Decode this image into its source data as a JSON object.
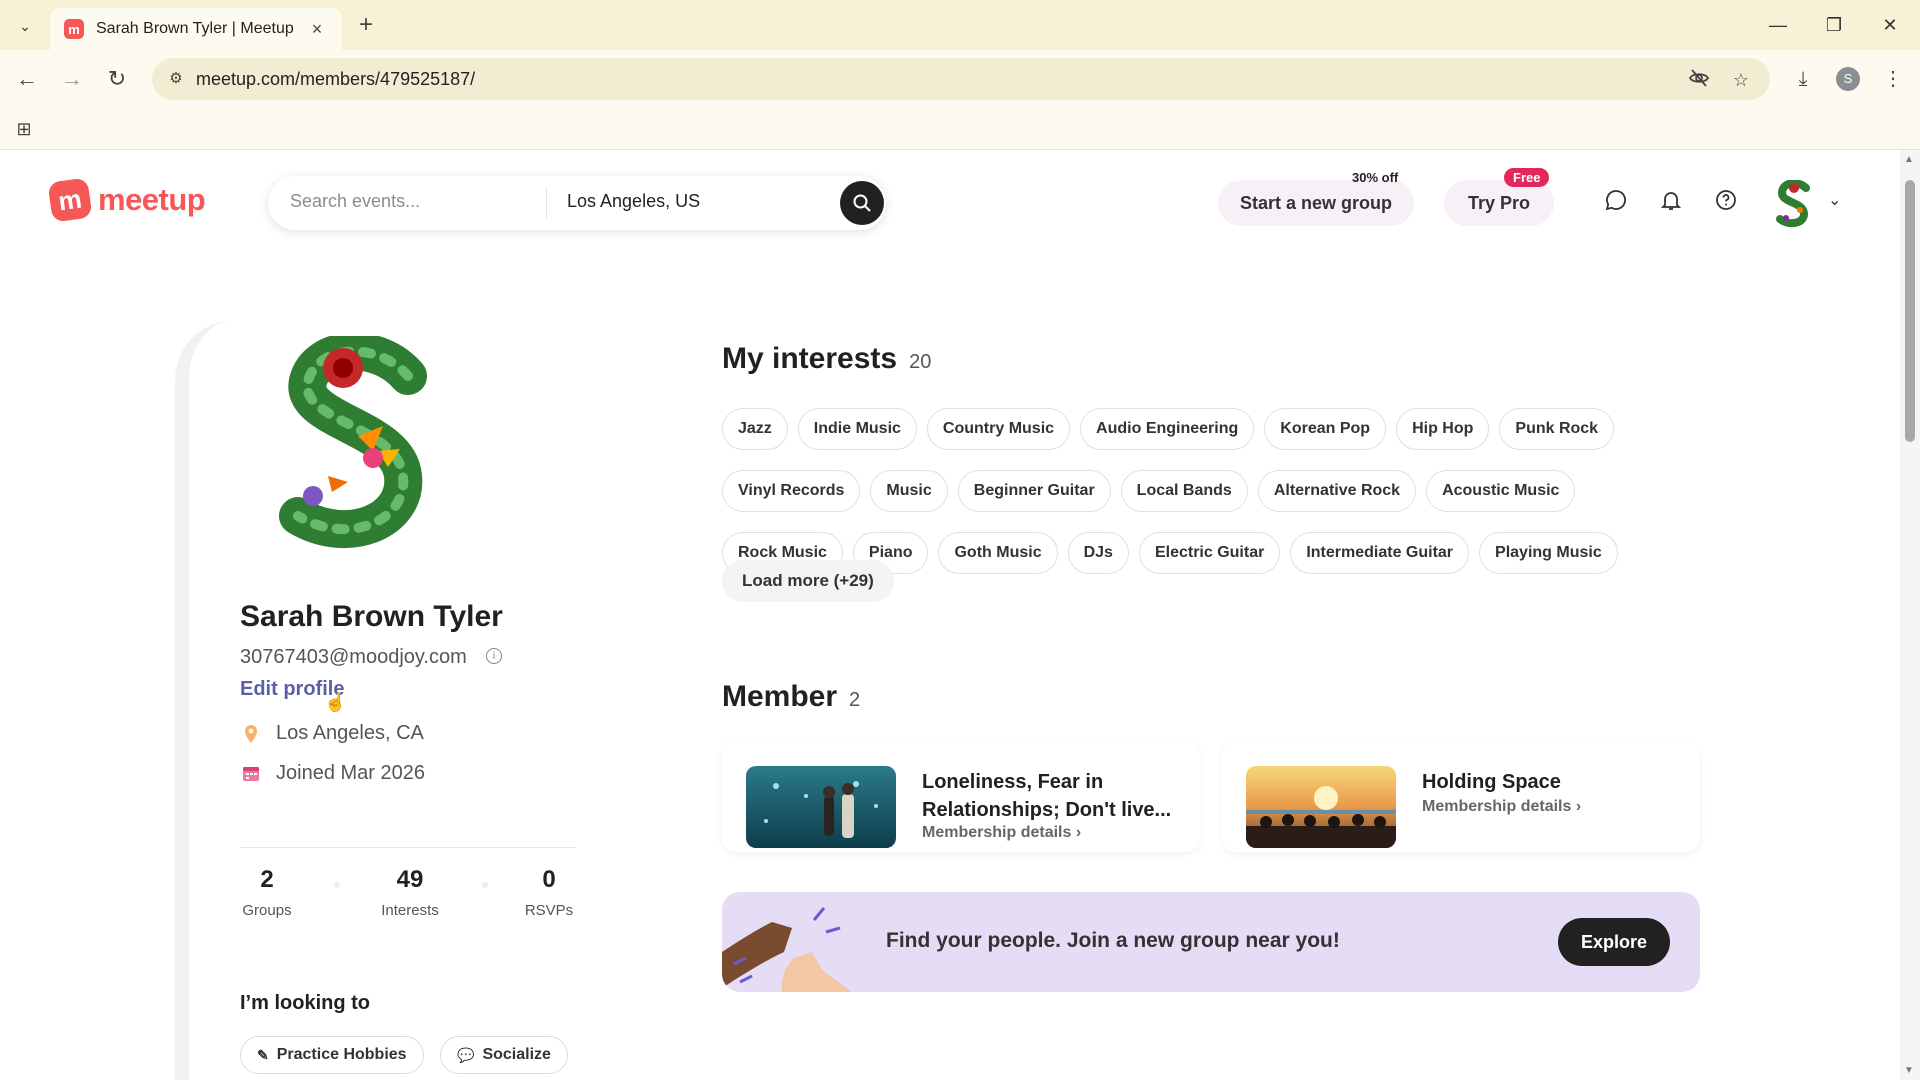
{
  "browser": {
    "tab_title": "Sarah Brown Tyler | Meetup",
    "favicon_letter": "m",
    "url": "meetup.com/members/479525187/",
    "profile_initial": "S"
  },
  "header": {
    "logo_text": "meetup",
    "search_placeholder": "Search events...",
    "location": "Los Angeles, US",
    "start_group_label": "Start a new group",
    "discount_label": "30% off",
    "try_pro_label": "Try Pro",
    "free_badge": "Free"
  },
  "profile": {
    "name": "Sarah Brown Tyler",
    "email": "30767403@moodjoy.com",
    "edit_label": "Edit profile",
    "location": "Los Angeles, CA",
    "joined": "Joined Mar 2026",
    "stats": [
      {
        "value": "2",
        "label": "Groups"
      },
      {
        "value": "49",
        "label": "Interests"
      },
      {
        "value": "0",
        "label": "RSVPs"
      }
    ],
    "looking_title": "I’m looking to",
    "goals": [
      "Practice Hobbies",
      "Socialize"
    ]
  },
  "interests": {
    "title": "My interests",
    "count": "20",
    "items": [
      "Jazz",
      "Indie Music",
      "Country Music",
      "Audio Engineering",
      "Korean Pop",
      "Hip Hop",
      "Punk Rock",
      "Vinyl Records",
      "Music",
      "Beginner Guitar",
      "Local Bands",
      "Alternative Rock",
      "Acoustic Music",
      "Rock Music",
      "Piano",
      "Goth Music",
      "DJs",
      "Electric Guitar",
      "Intermediate Guitar",
      "Playing Music"
    ],
    "load_more": "Load more (+29)"
  },
  "member": {
    "title": "Member",
    "count": "2",
    "groups": [
      {
        "title": "Loneliness, Fear in Relationships; Don't live...",
        "details": "Membership details"
      },
      {
        "title": "Holding Space",
        "details": "Membership details"
      }
    ]
  },
  "banner": {
    "text": "Find your people. Join a new group near you!",
    "button": "Explore"
  },
  "colors": {
    "brand": "#f65858",
    "link": "#5c5fa6",
    "pro_badge": "#e3285f",
    "banner_bg": "#e5dcf6"
  }
}
